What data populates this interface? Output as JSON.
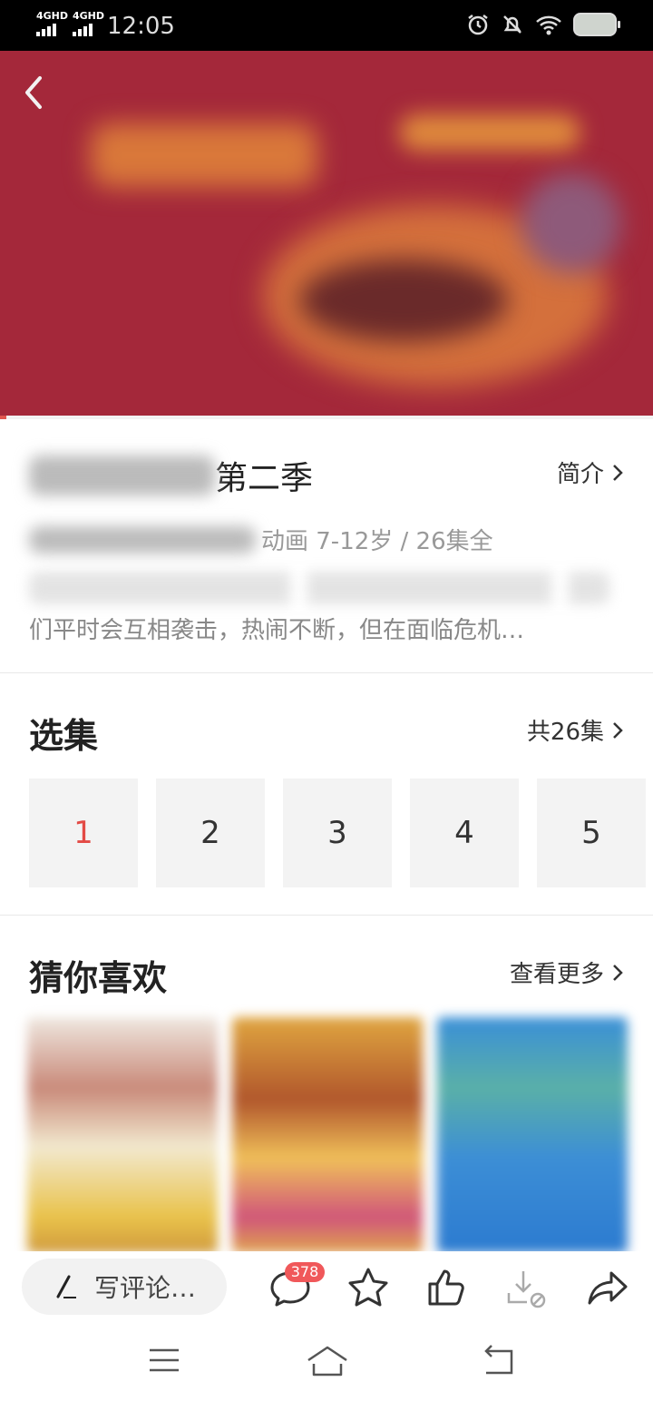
{
  "status_bar": {
    "network_1": "4GHD",
    "network_2": "4GHD",
    "time": "12:05",
    "icons": [
      "alarm-icon",
      "bell-muted-icon",
      "wifi-icon",
      "battery-icon"
    ]
  },
  "banner": {
    "back_icon": "chevron-left-icon",
    "progress_fraction": 0.01,
    "colors": {
      "background": "#a4283a",
      "progress": "#e0564f"
    }
  },
  "info": {
    "title_suffix": "第二季",
    "intro_label": "简介",
    "meta_visible": "动画 7-12岁 / 26集全",
    "desc_visible": "们平时会互相袭击，热闹不断，但在面临危机…"
  },
  "episodes": {
    "heading": "选集",
    "total_label": "共26集",
    "items": [
      "1",
      "2",
      "3",
      "4",
      "5"
    ],
    "active_index": 0,
    "active_color": "#e34a45"
  },
  "recommend": {
    "heading": "猜你喜欢",
    "more_label": "查看更多"
  },
  "action_bar": {
    "comment_placeholder": "写评论…",
    "comment_count": "378",
    "icons": [
      "pen-icon",
      "comment-icon",
      "star-icon",
      "thumbs-up-icon",
      "download-disabled-icon",
      "share-icon"
    ]
  },
  "system_nav": {
    "icons": [
      "menu-icon",
      "home-icon",
      "back-icon"
    ]
  }
}
